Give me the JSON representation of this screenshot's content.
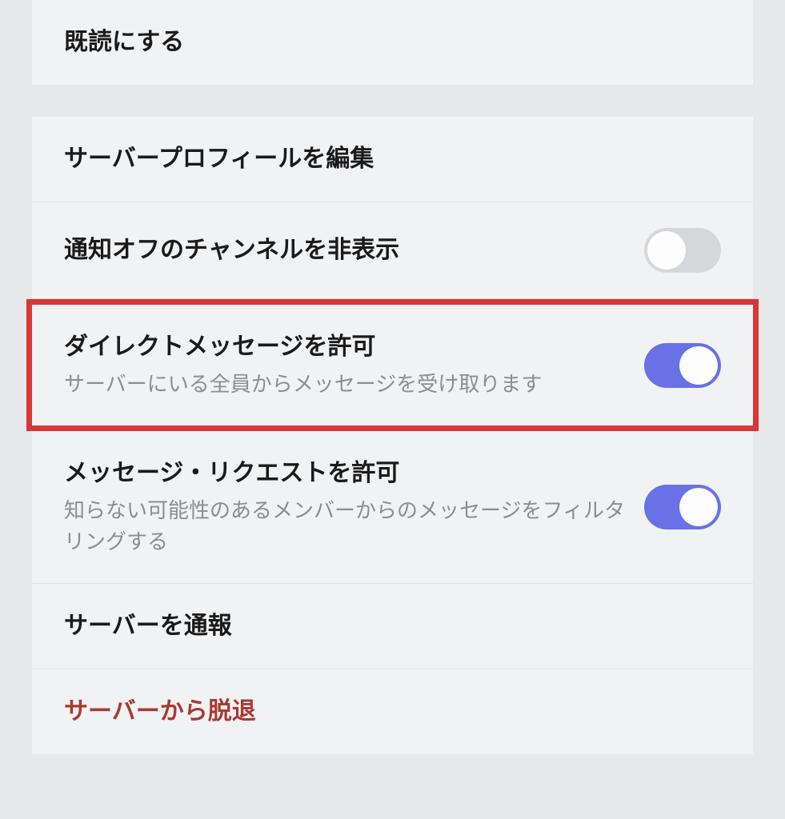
{
  "section1": {
    "mark_read": {
      "title": "既読にする"
    }
  },
  "section2": {
    "edit_profile": {
      "title": "サーバープロフィールを編集"
    },
    "hide_muted": {
      "title": "通知オフのチャンネルを非表示",
      "toggle": false
    },
    "allow_dm": {
      "title": "ダイレクトメッセージを許可",
      "subtitle": "サーバーにいる全員からメッセージを受け取ります",
      "toggle": true
    },
    "allow_requests": {
      "title": "メッセージ・リクエストを許可",
      "subtitle": "知らない可能性のあるメンバーからのメッセージをフィルタリングする",
      "toggle": true
    },
    "report": {
      "title": "サーバーを通報"
    },
    "leave": {
      "title": "サーバーから脱退"
    }
  }
}
